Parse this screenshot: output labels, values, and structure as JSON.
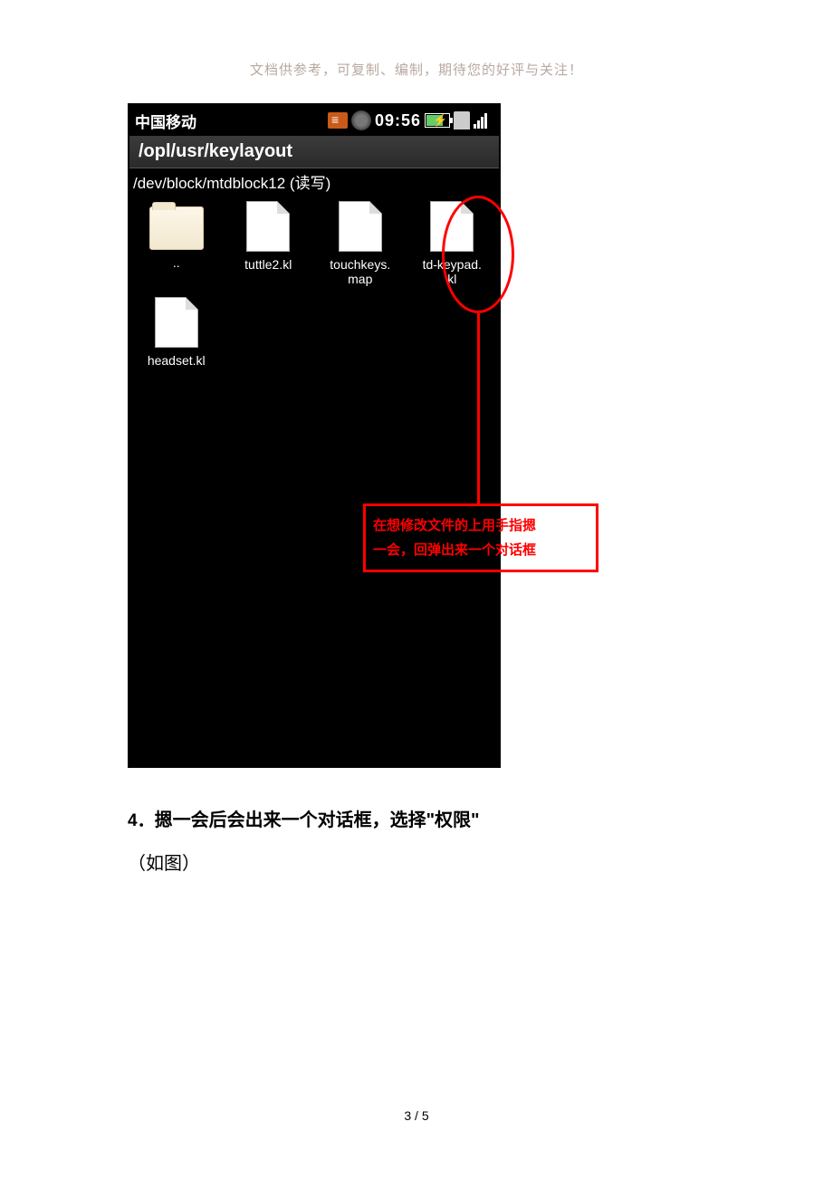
{
  "header_note": "文档供参考，可复制、编制，期待您的好评与关注！",
  "status": {
    "carrier": "中国移动",
    "clock": "09:56"
  },
  "path": "/opl/usr/keylayout",
  "mount": "/dev/block/mtdblock12 (读写)",
  "files": [
    {
      "name": "..",
      "type": "folder"
    },
    {
      "name": "tuttle2.kl",
      "type": "file"
    },
    {
      "name": "touchkeys.\nmap",
      "type": "file"
    },
    {
      "name": "td-keypad.\nkl",
      "type": "file"
    },
    {
      "name": "headset.kl",
      "type": "file"
    }
  ],
  "annotation": {
    "line1": "在想修改文件的上用手指摁",
    "line2": "一会，回弹出来一个对话框"
  },
  "body": {
    "step_num": "4．",
    "step_text": "摁一会后会出来一个对话框，选择\"权限\"",
    "sub": "（如图）"
  },
  "page_number": "3 / 5"
}
